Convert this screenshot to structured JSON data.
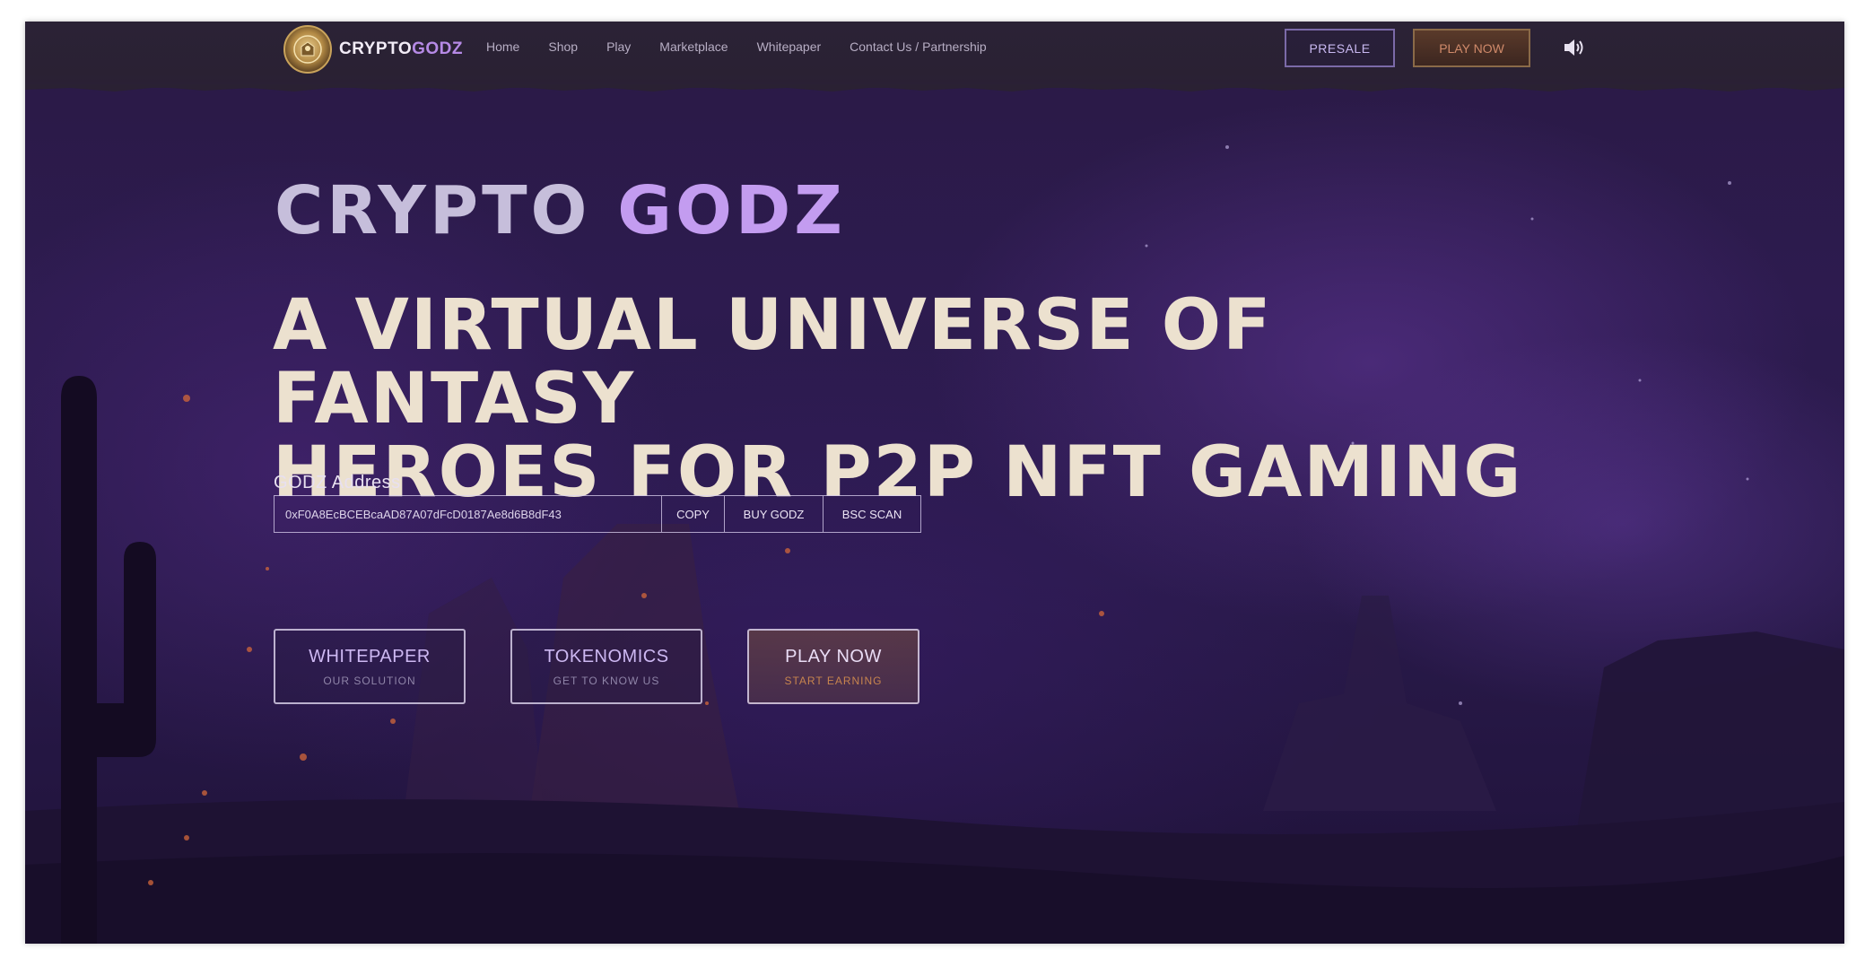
{
  "nav": {
    "logo_text_1": "CRYPTO",
    "logo_text_2": "GODZ",
    "links": [
      "Home",
      "Shop",
      "Play",
      "Marketplace",
      "Whitepaper",
      "Contact Us / Partnership"
    ],
    "presale_label": "PRESALE",
    "play_now_label": "PLAY NOW"
  },
  "hero": {
    "brand_1": "CRYPTO",
    "brand_2": "GODZ",
    "headline_line1": "A VIRTUAL UNIVERSE OF FANTASY",
    "headline_line2": "HEROES FOR P2P NFT GAMING"
  },
  "address": {
    "label": "GODZ Address",
    "value": "0xF0A8EcBCEBcaAD87A07dFcD0187Ae8d6B8dF43",
    "copy_label": "COPY",
    "buy_label": "BUY GODZ",
    "scan_label": "BSC SCAN"
  },
  "cta": {
    "whitepaper": {
      "title": "WHITEPAPER",
      "subtitle": "OUR SOLUTION"
    },
    "tokenomics": {
      "title": "TOKENOMICS",
      "subtitle": "GET TO KNOW US"
    },
    "play": {
      "title": "PLAY NOW",
      "subtitle": "START EARNING"
    }
  },
  "colors": {
    "accent": "#c39cf0",
    "headline": "#ece1cf",
    "background": "#2d1b4f"
  },
  "icons": [
    "logo-badge-icon",
    "sound-icon"
  ]
}
